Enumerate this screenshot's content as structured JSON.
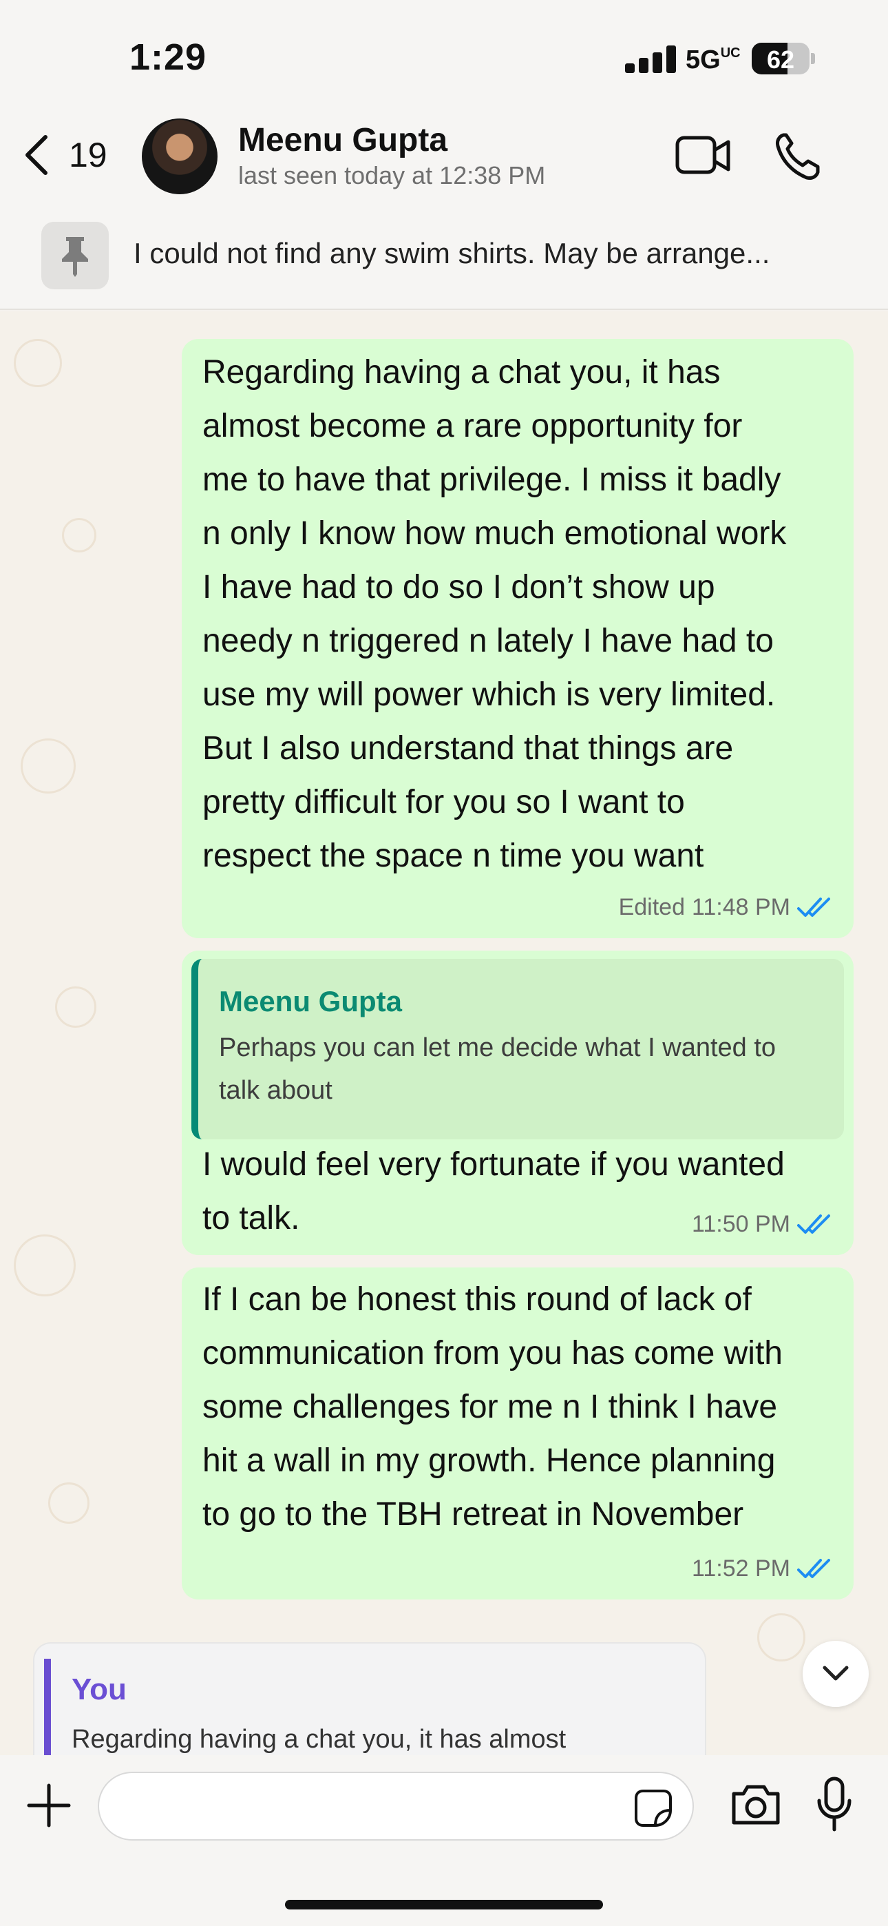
{
  "status_bar": {
    "time": "1:29",
    "network": "5G",
    "network_suffix": "UC",
    "battery": "62",
    "battery_level": 0.62
  },
  "header": {
    "back_count": "19",
    "contact_name": "Meenu Gupta",
    "last_seen": "last seen today at 12:38 PM",
    "icons": [
      "chevron-left-icon",
      "video-camera-icon",
      "phone-icon"
    ]
  },
  "pinned": {
    "text": "I could not find any swim shirts. May be arrange..."
  },
  "messages": [
    {
      "lines": [
        "Regarding having a chat you, it has",
        "almost become a rare opportunity for",
        "me to have that privilege. I miss it badly",
        "n only I know how much emotional work",
        "I have had to do so I don’t show up",
        "needy n triggered n lately I have had to",
        "use my will power which is very limited.",
        "But I also understand that things are",
        "pretty difficult for you so I want to",
        "respect the space n time you want"
      ],
      "edited": "Edited",
      "time": "11:48 PM"
    },
    {
      "quote_name": "Meenu Gupta",
      "quote_lines": [
        "Perhaps you can let me decide what I wanted to",
        "talk about"
      ],
      "lines": [
        "I would feel very fortunate if you wanted",
        "to talk."
      ],
      "time": "11:50 PM"
    },
    {
      "lines": [
        "If I can be honest this round of lack of",
        "communication from you has come with",
        "some challenges for me n I think I have",
        "hit a wall in my growth. Hence planning",
        "to go to the TBH retreat in November"
      ],
      "time": "11:52 PM"
    }
  ],
  "reply_preview": {
    "name": "You",
    "text": "Regarding having a chat you, it has almost"
  },
  "colors": {
    "outgoing_bubble": "#d9fdd3",
    "read_ticks": "#1d8df2",
    "quote_accent": "#068a76",
    "reply_accent": "#6a4ed1"
  }
}
